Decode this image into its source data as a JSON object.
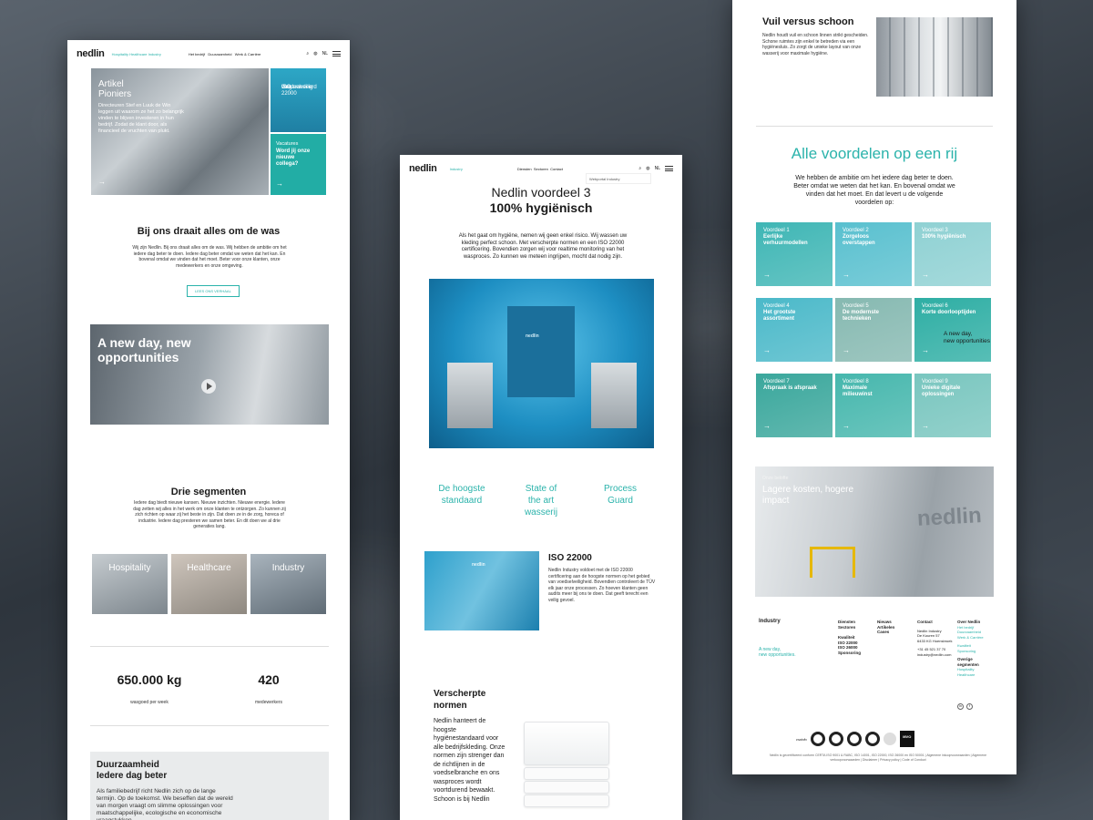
{
  "colors": {
    "teal": "#2bb3ab",
    "teal_dark": "#22ada5"
  },
  "common": {
    "logo": "nedlin",
    "language": "NL",
    "arrow": "→"
  },
  "panel1": {
    "nav": {
      "segments": "Hospitality  Healthcare  Industry",
      "links": [
        "Het bedrijf",
        "Duurzaamheid",
        "Werk & Carrière"
      ]
    },
    "hero": {
      "title_line1": "Artikel",
      "title_line2": "Pioniers",
      "text": "Directeuren Stef en Luuk de Win leggen uit waarom ze het zo belangrijk vinden te blijven investeren in hun bedrijf. Zodat de klant door, als financieel de vruchten van plukt."
    },
    "tile_iso": {
      "line1": "ISO 22000",
      "line2": "Gegarandeerd",
      "line3": "voedselveilig"
    },
    "tile_vacatures": {
      "label": "Vacatures",
      "line1": "Word jij onze",
      "line2": "nieuwe",
      "line3": "collega?"
    },
    "about": {
      "title": "Bij ons draait alles om de was",
      "text": "Wij zijn Nedlin. Bij ons draait alles om de was. Wij hebben de ambitie om het iedere dag beter te doen. Iedere dag beter omdat we weten dat het kan. En bovenal omdat we vinden dat het moet. Beter voor onze klanten, onze medewerkers en onze omgeving.",
      "button": "LEES ONS VERHAAL"
    },
    "video": {
      "line1": "A new day, new",
      "line2": "opportunities"
    },
    "segments": {
      "title": "Drie segmenten",
      "text": "Iedere dag biedt nieuwe kansen. Nieuwe inzichten. Nieuwe energie. Iedere dag zetten wij alles in het werk om onze klanten te ontzorgen. Zo kunnen zij zich richten op waar zij het beste in zijn. Dat doen ze in de zorg, horeca of industrie. Iedere dag presteren we samen beter. En dit doen we al drie generaties lang.",
      "items": [
        "Hospitality",
        "Healthcare",
        "Industry"
      ]
    },
    "stats": [
      {
        "num": "650.000 kg",
        "label": "wasgoed per week"
      },
      {
        "num": "420",
        "label": "medewerkers"
      }
    ],
    "sustainability": {
      "line1": "Duurzaamheid",
      "line2": "Iedere dag beter",
      "text": "Als familiebedrijf richt Nedlin zich op de lange termijn. Op de toekomst. We beseffen dat de wereld van morgen vraagt om slimme oplossingen voor maatschappelijke, ecologische en economische vraagstukken."
    }
  },
  "panel2": {
    "nav": {
      "segment": "Industry",
      "links": [
        "Diensten",
        "Sectoren",
        "Contact"
      ],
      "dropdown": "Webportal Industry"
    },
    "title_line1": "Nedlin voordeel 3",
    "title_line2": "100% hygiënisch",
    "intro": "Als het gaat om hygiëne, nemen wij geen enkel risico. Wij wassen uw kleding perfect schoon. Met verscherpte normen en een ISO 22000 certificering. Bovendien zorgen wij voor realtime monitoring van het wasproces. Zo kunnen we meteen ingrijpen, mocht dat nodig zijn.",
    "gate_logo": "nedlin",
    "features": [
      {
        "line1": "De hoogste",
        "line2": "standaard",
        "line3": ""
      },
      {
        "line1": "State of",
        "line2": "the art",
        "line3": "wasserij"
      },
      {
        "line1": "Process",
        "line2": "Guard",
        "line3": ""
      }
    ],
    "iso": {
      "title": "ISO 22000",
      "logo": "nedlin",
      "text": "Nedlin Industry voldoet met de ISO 22000 certificering aan de hoogste normen op het gebied van voedselveiligheid. Bovendien controleert de TÜV elk jaar onze processen. Zo hoeven klanten geen audits meer bij ons te doen. Dat geeft terecht een veilig gevoel."
    },
    "norms": {
      "title_line1": "Verscherpte",
      "title_line2": "normen",
      "text": "Nedlin hanteert de hoogste hygiënestandaard voor alle bedrijfskleding. Onze normen zijn strenger dan de richtlijnen in de voedselbranche en ons wasproces wordt voortdurend bewaakt. Schoon is bij Nedlin"
    }
  },
  "panel3": {
    "dirty": {
      "title": "Vuil versus schoon",
      "text": "Nedlin houdt vuil en schoon linnen strikt gescheiden. Schone ruimtes zijn enkel te betreden via een hygiënesluis. Zo zorgt de unieke layout van onze wasserij voor maximale hygiëne."
    },
    "advantages": {
      "title": "Alle voordelen op een rij",
      "text": "We hebben de ambitie om het iedere dag beter te doen. Beter omdat we weten dat het kan. En bovenal omdat we vinden dat het moet. En dat levert u de volgende voordelen op:",
      "cells": [
        {
          "n": "Voordeel 1",
          "t1": "Eerlijke",
          "t2": "verhuurmodellen",
          "extra1": "",
          "extra2": "",
          "color": "#3fb6b5"
        },
        {
          "n": "Voordeel 2",
          "t1": "Zorgeloos",
          "t2": "overstappen",
          "extra1": "",
          "extra2": "",
          "color": "#59c0cf"
        },
        {
          "n": "Voordeel 3",
          "t1": "100% hygiënisch",
          "t2": "",
          "extra1": "",
          "extra2": "",
          "color": "#8fd1d3"
        },
        {
          "n": "Voordeel 4",
          "t1": "Het grootste",
          "t2": "assortiment",
          "extra1": "",
          "extra2": "",
          "color": "#4bb9c9"
        },
        {
          "n": "Voordeel 5",
          "t1": "De modernste",
          "t2": "technieken",
          "extra1": "",
          "extra2": "",
          "color": "#86b9b1"
        },
        {
          "n": "Voordeel 6",
          "t1": "Korte doorlooptijden",
          "t2": "",
          "extra1": "A new day,",
          "extra2": "new opportunities",
          "color": "#2eaea4"
        },
        {
          "n": "Voordeel 7",
          "t1": "Afspraak is afspraak",
          "t2": "",
          "extra1": "",
          "extra2": "",
          "color": "#3aa79c"
        },
        {
          "n": "Voordeel 8",
          "t1": "Maximale",
          "t2": "milieuwinst",
          "extra1": "",
          "extra2": "",
          "color": "#46b7ad"
        },
        {
          "n": "Voordeel 9",
          "t1": "Unieke digitale",
          "t2": "oplossingen",
          "extra1": "",
          "extra2": "",
          "color": "#79c6bf"
        }
      ]
    },
    "truck": {
      "label": "Onze belofte",
      "line1": "Lagere kosten, hogere",
      "line2": "impact",
      "brand": "nedlin"
    },
    "footer": {
      "brand": "Industry",
      "tagline1": "A new day,",
      "tagline2": "new opportunities.",
      "col1": [
        "Diensten",
        "Sectoren"
      ],
      "col1b": [
        "Kwaliteit",
        "ISO 22000",
        "ISO 26000",
        "Sponsoring"
      ],
      "col2": [
        "Nieuws",
        "Artikelen",
        "Cases"
      ],
      "contact": {
        "title": "Contact",
        "lines": [
          "Nedlin Industry",
          "De Kouren 57",
          "6433 KG Hoensbroek"
        ],
        "phone": "+31 45 521 37 70",
        "email": "industry@nedlin.com"
      },
      "about": {
        "title": "Over Nedlin",
        "links": [
          "Het bedrijf",
          "Duurzaamheid",
          "Werk & Carrière"
        ],
        "links2": [
          "Kwaliteit",
          "Sponsoring"
        ],
        "other_title1": "Overige",
        "other_title2": "segmenten",
        "other": [
          "Hospitality",
          "Healthcare"
        ]
      },
      "social": [
        "in",
        "f"
      ],
      "cert_label": "csrinfo",
      "mvo": "MVO",
      "legal": "Nedlin is gecertificeerd conform CERTA ISO 9001 & RABC, ISO 14001, ISO 22000, ISO 26000 en ISO 50001 | Algemene inkoopvoorwaarden | Algemene verkoopvoorwaarden | Disclaimer | Privacy policy | Code of Conduct"
    }
  }
}
